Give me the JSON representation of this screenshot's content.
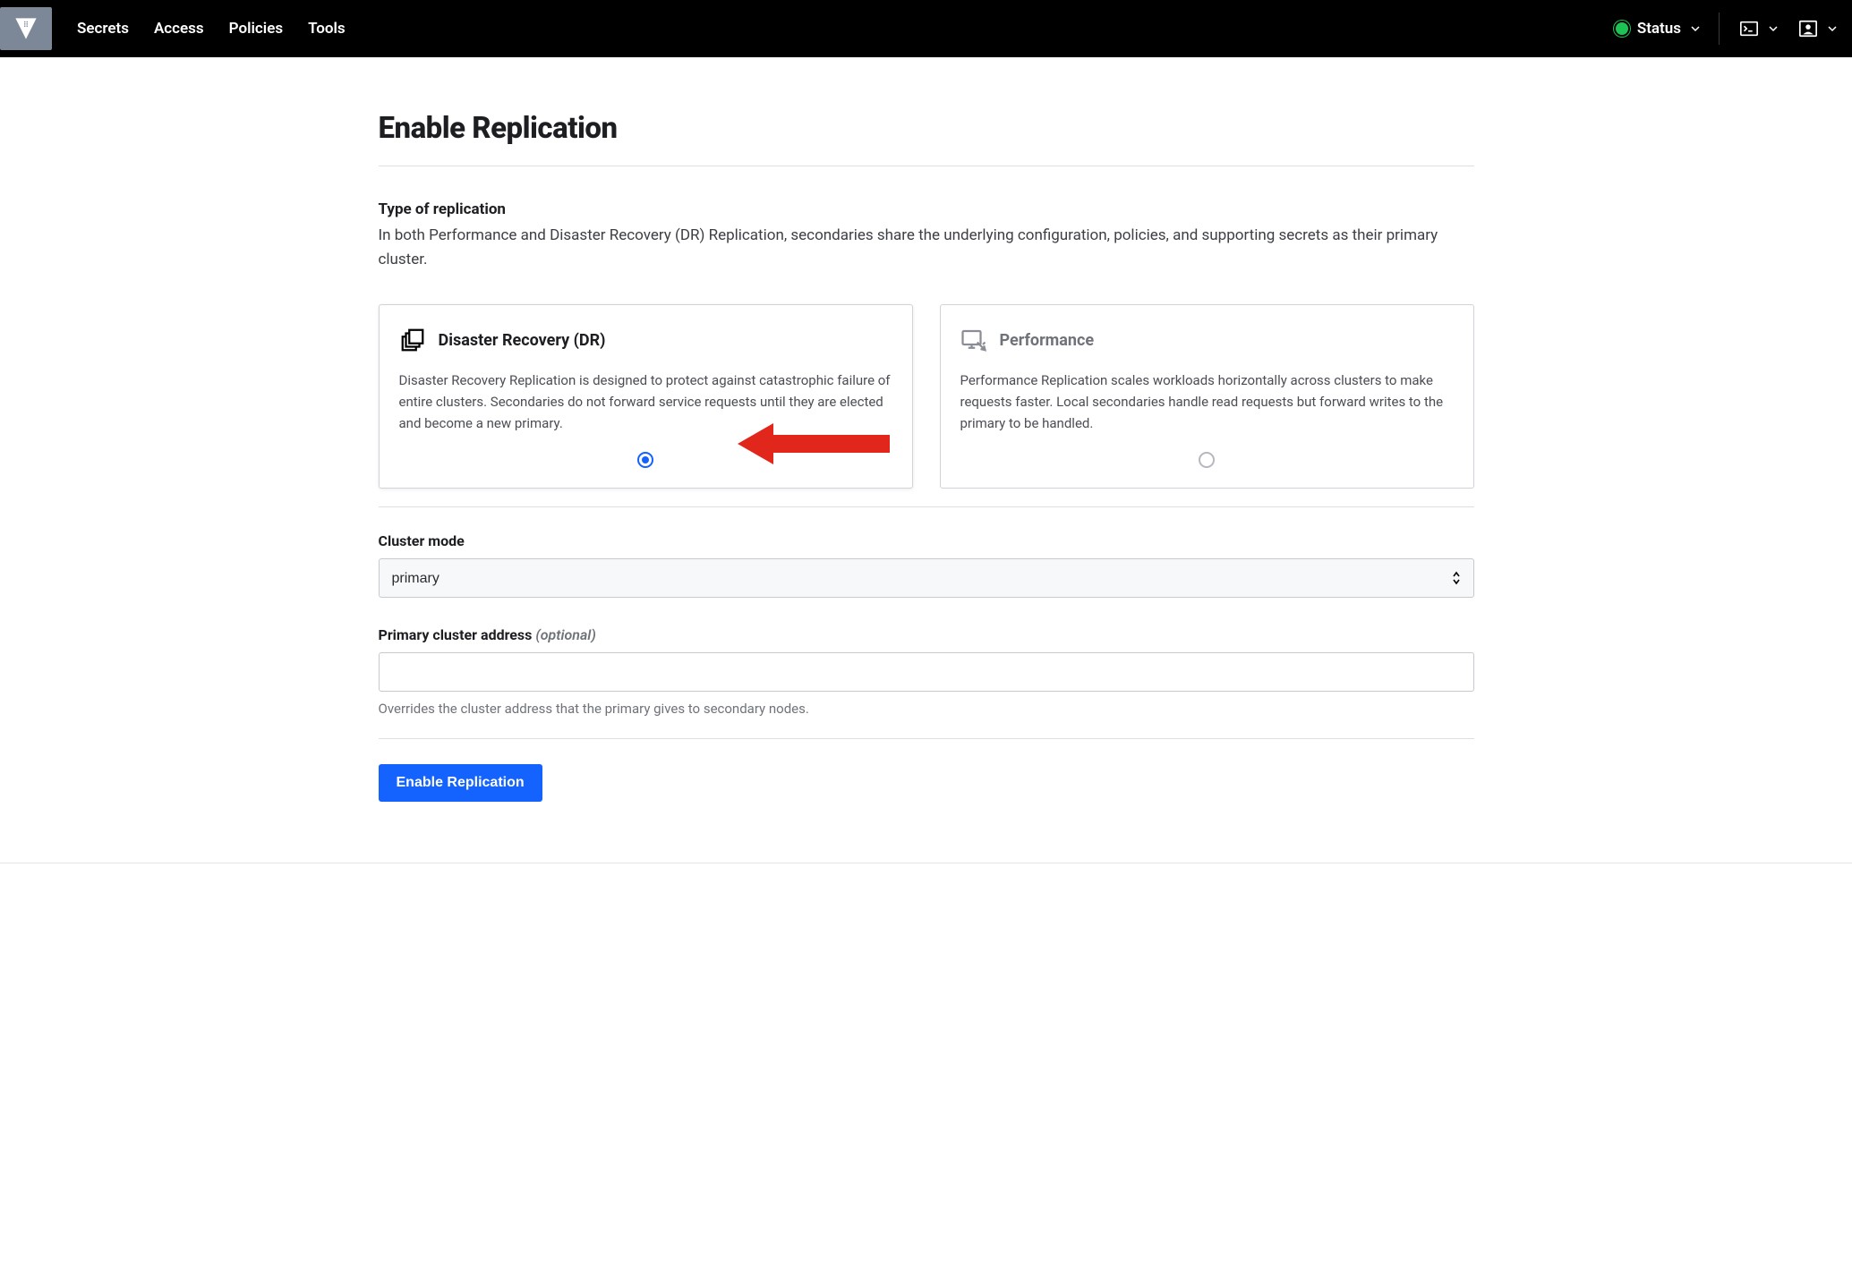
{
  "nav": {
    "items": [
      "Secrets",
      "Access",
      "Policies",
      "Tools"
    ],
    "status_label": "Status"
  },
  "page": {
    "title": "Enable Replication",
    "type_label": "Type of replication",
    "type_desc": "In both Performance and Disaster Recovery (DR) Replication, secondaries share the underlying configuration, policies, and supporting secrets as their primary cluster."
  },
  "options": {
    "dr": {
      "title": "Disaster Recovery (DR)",
      "desc": "Disaster Recovery Replication is designed to protect against catastrophic failure of entire clusters. Secondaries do not forward service requests until they are elected and become a new primary.",
      "selected": true
    },
    "perf": {
      "title": "Performance",
      "desc": "Performance Replication scales workloads horizontally across clusters to make requests faster. Local secondaries handle read requests but forward writes to the primary to be handled.",
      "selected": false
    }
  },
  "form": {
    "cluster_mode_label": "Cluster mode",
    "cluster_mode_value": "primary",
    "primary_addr_label": "Primary cluster address ",
    "primary_addr_optional": "(optional)",
    "primary_addr_value": "",
    "primary_addr_help": "Overrides the cluster address that the primary gives to secondary nodes.",
    "submit_label": "Enable Replication"
  }
}
